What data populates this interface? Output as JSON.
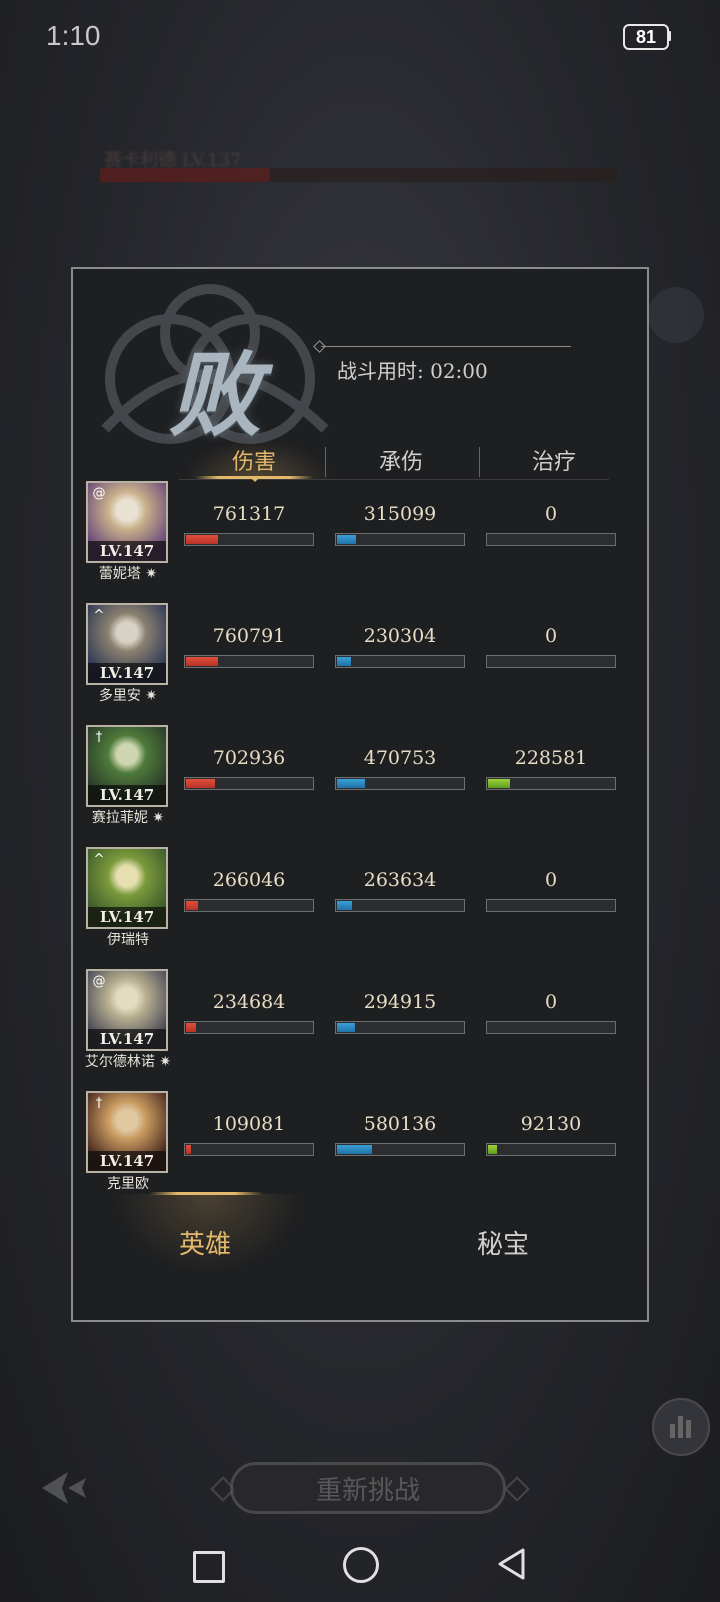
{
  "status_bar": {
    "time": "1:10",
    "battery": "81"
  },
  "background": {
    "boss_label": "赛卡利德 LV.137",
    "retry_label": "重新挑战"
  },
  "result": {
    "title": "败",
    "battle_time": "战斗用时: 02:00"
  },
  "stat_tabs": [
    "伤害",
    "承伤",
    "治疗"
  ],
  "bottom_tabs": [
    "英雄",
    "秘宝"
  ],
  "colors": {
    "gold": "#e3b86a",
    "damage": "#d9432f",
    "taken": "#2f8fcf",
    "heal": "#86c22e"
  },
  "heroes": [
    {
      "level": "LV.147",
      "name": "蕾妮塔 ✷",
      "class_icon": "spiral-icon",
      "damage": "761317",
      "taken": "315099",
      "heal": "0",
      "damage_pct": 0.25,
      "taken_pct": 0.15,
      "heal_pct": 0
    },
    {
      "level": "LV.147",
      "name": "多里安 ✷",
      "class_icon": "wing-icon",
      "damage": "760791",
      "taken": "230304",
      "heal": "0",
      "damage_pct": 0.25,
      "taken_pct": 0.11,
      "heal_pct": 0
    },
    {
      "level": "LV.147",
      "name": "赛拉菲妮 ✷",
      "class_icon": "cross-icon",
      "damage": "702936",
      "taken": "470753",
      "heal": "228581",
      "damage_pct": 0.23,
      "taken_pct": 0.22,
      "heal_pct": 0.17
    },
    {
      "level": "LV.147",
      "name": "伊瑞特",
      "class_icon": "wing-icon",
      "damage": "266046",
      "taken": "263634",
      "heal": "0",
      "damage_pct": 0.09,
      "taken_pct": 0.12,
      "heal_pct": 0
    },
    {
      "level": "LV.147",
      "name": "艾尔德林诺 ✷",
      "class_icon": "spiral-icon",
      "damage": "234684",
      "taken": "294915",
      "heal": "0",
      "damage_pct": 0.08,
      "taken_pct": 0.14,
      "heal_pct": 0
    },
    {
      "level": "LV.147",
      "name": "克里欧",
      "class_icon": "cross-icon",
      "damage": "109081",
      "taken": "580136",
      "heal": "92130",
      "damage_pct": 0.04,
      "taken_pct": 0.27,
      "heal_pct": 0.07
    }
  ]
}
